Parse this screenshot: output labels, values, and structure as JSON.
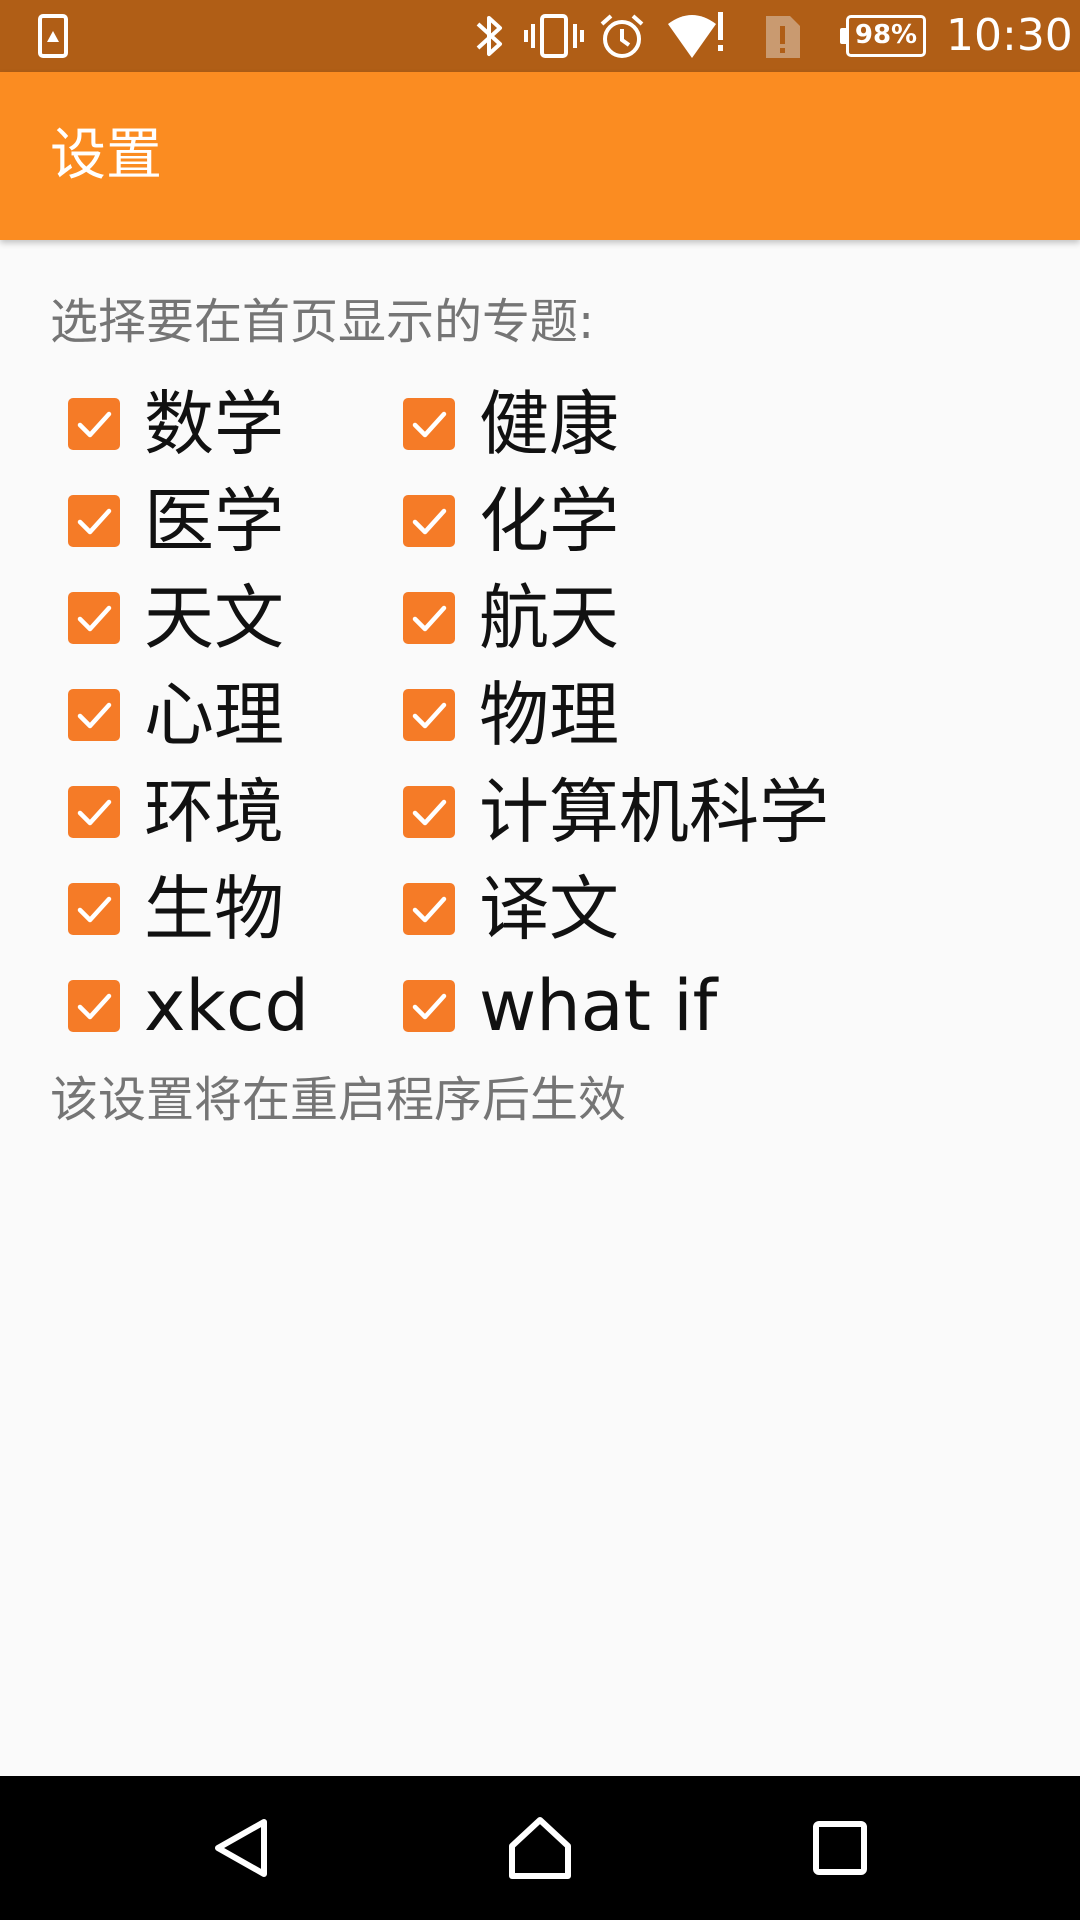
{
  "status_bar": {
    "battery": "98%",
    "time": "10:30",
    "icons": [
      "screenshot-alert-icon",
      "bluetooth-icon",
      "vibrate-icon",
      "alarm-icon",
      "wifi-alert-icon",
      "sim-alert-icon",
      "battery-icon"
    ]
  },
  "app_bar": {
    "title": "设置"
  },
  "settings": {
    "instruction": "选择要在首页显示的专题:",
    "topics": [
      {
        "label": "数学",
        "checked": true
      },
      {
        "label": "健康",
        "checked": true
      },
      {
        "label": "医学",
        "checked": true
      },
      {
        "label": "化学",
        "checked": true
      },
      {
        "label": "天文",
        "checked": true
      },
      {
        "label": "航天",
        "checked": true
      },
      {
        "label": "心理",
        "checked": true
      },
      {
        "label": "物理",
        "checked": true
      },
      {
        "label": "环境",
        "checked": true
      },
      {
        "label": "计算机科学",
        "checked": true
      },
      {
        "label": "生物",
        "checked": true
      },
      {
        "label": "译文",
        "checked": true
      },
      {
        "label": "xkcd",
        "checked": true
      },
      {
        "label": "what if",
        "checked": true
      }
    ],
    "note": "该设置将在重启程序后生效"
  },
  "nav_bar": {
    "buttons": [
      "back-icon",
      "home-icon",
      "recents-icon"
    ]
  },
  "colors": {
    "status_bar": "#b05e16",
    "app_bar": "#fb8c21",
    "checkbox": "#f57b27",
    "background": "#fafafa"
  }
}
